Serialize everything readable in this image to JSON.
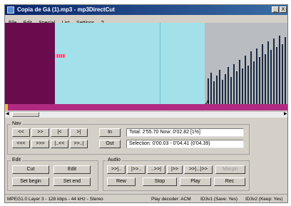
{
  "window": {
    "title": "Copia de Gá (1).mp3 - mp3DirectCut",
    "min_label": "_",
    "close_label": "X"
  },
  "menu": [
    "File",
    "Edit",
    "Special",
    "List",
    "Settings",
    "?"
  ],
  "waveform": {
    "selection_color": "#6a0b4e",
    "wave_color": "#a2e1ea",
    "cursor_icon": "pointer-cursor-icon"
  },
  "nav": {
    "label": "Nav",
    "buttons_row1": [
      "<<",
      ">>",
      "|<",
      ">|"
    ],
    "buttons_row2": [
      "<<<",
      ">>>",
      "|..<<",
      ">>..|"
    ],
    "in_label": "In",
    "out_label": "Out",
    "total_text": "Total: 2'55.70  Now: 0'02.82  [1%]",
    "selection_text": "Selection: 0'00.03 - 0'04.41 (0'04.39)"
  },
  "edit": {
    "label": "Edit",
    "cut": "Cut",
    "edit": "Edit",
    "set_begin": "Set begin",
    "set_end": "Set end"
  },
  "audio": {
    "label": "Audio",
    "row1": [
      ">>|..",
      "|>>..",
      "..>>|",
      "|>>",
      ">>|...|>>",
      "Margin"
    ],
    "rew": "Rew",
    "stop": "Stop",
    "play": "Play",
    "rec": "Rec"
  },
  "status": {
    "format": "MPEG1.0 Layer 3 - 128 kbps - 44 kHz - Stereo",
    "decoder": "Play decoder: ACM",
    "id3v1": "ID3v1 (Save: Yes)",
    "id3v2": "ID3v2 (Keep: Yes)"
  }
}
